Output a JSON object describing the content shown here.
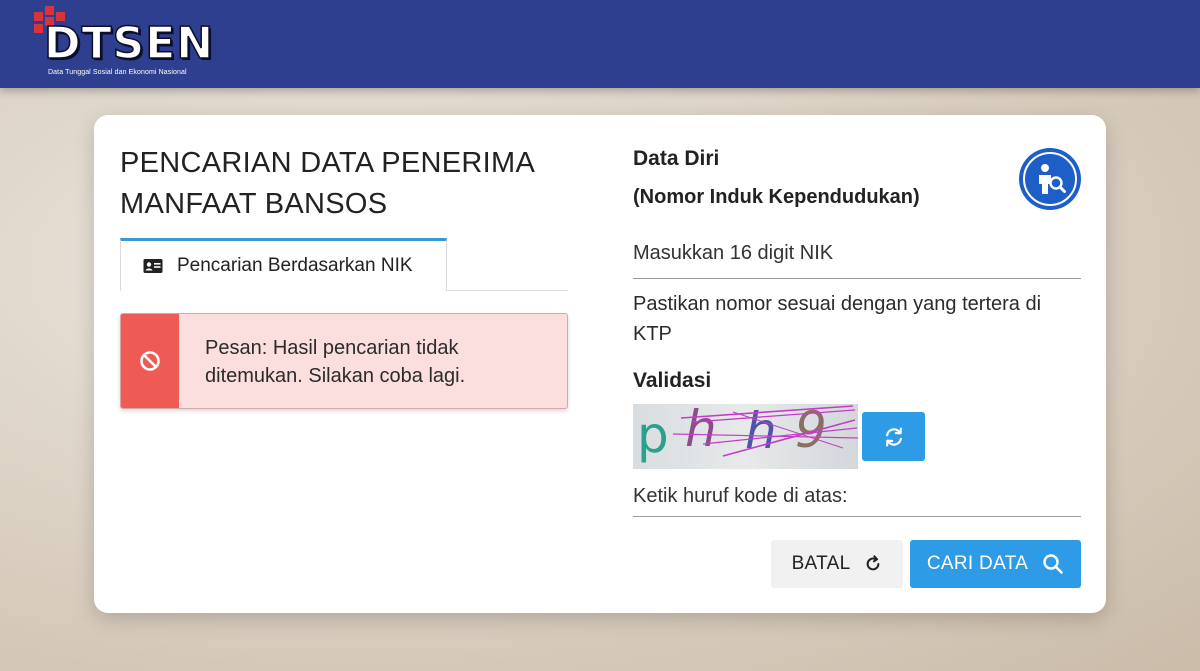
{
  "header": {
    "logo_text": "DTSEN",
    "logo_subtitle": "Data Tunggal Sosial dan Ekonomi Nasional",
    "background_color": "#2e3f8f"
  },
  "left_panel": {
    "title": "PENCARIAN DATA PENERIMA MANFAAT BANSOS",
    "tab": {
      "label": "Pencarian Berdasarkan NIK",
      "icon": "id-card-icon"
    },
    "alert": {
      "icon": "ban-icon",
      "message": "Pesan: Hasil pencarian tidak ditemukan. Silakan coba lagi.",
      "accent_color": "#ee5a54"
    }
  },
  "right_panel": {
    "section_title": "Data Diri",
    "section_subtitle": "(Nomor Induk Kependudukan)",
    "profile_icon": "user-search-icon",
    "nik_input": {
      "placeholder": "Masukkan 16 digit NIK",
      "value": ""
    },
    "hint": "Pastikan nomor sesuai dengan yang tertera di KTP",
    "validation": {
      "title": "Validasi",
      "captcha_chars": [
        "p",
        "h",
        "h",
        "9"
      ],
      "refresh_icon": "refresh-icon",
      "input_placeholder": "Ketik huruf kode di atas:",
      "input_value": ""
    },
    "buttons": {
      "cancel_label": "BATAL",
      "cancel_icon": "rotate-icon",
      "search_label": "CARI DATA",
      "search_icon": "search-icon",
      "primary_color": "#2e9be6"
    }
  }
}
